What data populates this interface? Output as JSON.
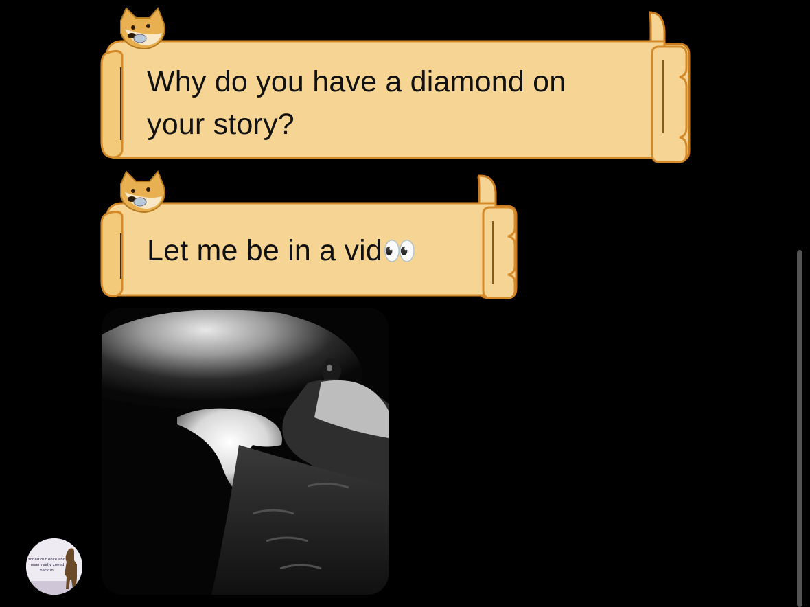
{
  "messages": [
    {
      "text": "Why do you have a diamond on your story?",
      "sticker_icon": "doge-icon"
    },
    {
      "text": "Let me be in a vid",
      "emoji": "👀",
      "sticker_icon": "doge-icon"
    }
  ],
  "photo": {
    "icon": "pigeon-closeup-image"
  },
  "avatar": {
    "caption": "zoned out once and never really zoned back in",
    "icon": "avatar-image"
  },
  "colors": {
    "background": "#000000",
    "bubble_fill": "#f6d594",
    "bubble_edge": "#d58a2a",
    "text": "#111111",
    "scrollbar": "#555555"
  }
}
